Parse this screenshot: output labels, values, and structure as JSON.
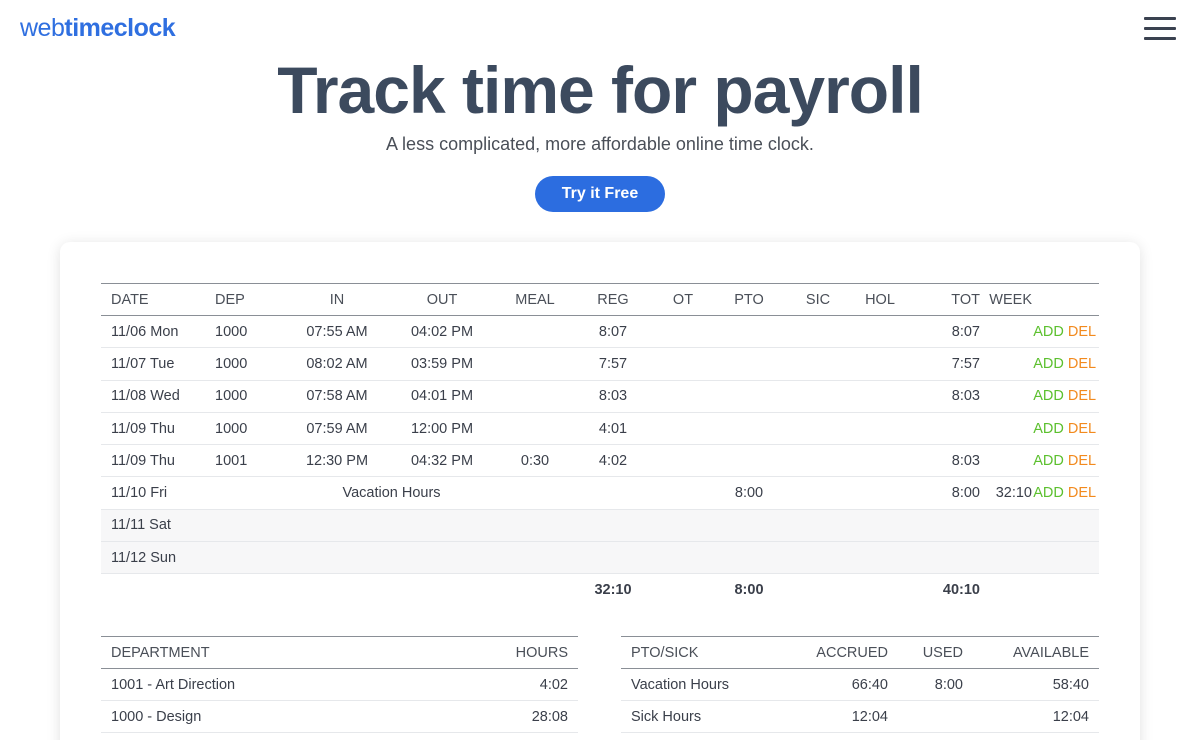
{
  "header": {
    "logo_thin": "web",
    "logo_bold": "timeclock",
    "menu_icon": "hamburger-menu-icon"
  },
  "hero": {
    "title": "Track time for payroll",
    "subtitle": "A less complicated, more affordable online time clock.",
    "cta_label": "Try it Free"
  },
  "colors": {
    "brand_blue": "#2c6de0",
    "title_slate": "#3c4a5e",
    "add_green": "#5cc02e",
    "del_orange": "#f28a1e"
  },
  "timesheet": {
    "columns": [
      "DATE",
      "DEP",
      "IN",
      "OUT",
      "MEAL",
      "REG",
      "OT",
      "PTO",
      "SIC",
      "HOL",
      "TOT",
      "WEEK",
      "",
      ""
    ],
    "rows": [
      {
        "date": "11/06 Mon",
        "dep": "1000",
        "in": "07:55 AM",
        "out": "04:02 PM",
        "meal": "",
        "reg": "8:07",
        "ot": "",
        "pto": "",
        "sic": "",
        "hol": "",
        "tot": "8:07",
        "week": "",
        "add": "ADD",
        "del": "DEL"
      },
      {
        "date": "11/07 Tue",
        "dep": "1000",
        "in": "08:02 AM",
        "out": "03:59 PM",
        "meal": "",
        "reg": "7:57",
        "ot": "",
        "pto": "",
        "sic": "",
        "hol": "",
        "tot": "7:57",
        "week": "",
        "add": "ADD",
        "del": "DEL"
      },
      {
        "date": "11/08 Wed",
        "dep": "1000",
        "in": "07:58 AM",
        "out": "04:01 PM",
        "meal": "",
        "reg": "8:03",
        "ot": "",
        "pto": "",
        "sic": "",
        "hol": "",
        "tot": "8:03",
        "week": "",
        "add": "ADD",
        "del": "DEL"
      },
      {
        "date": "11/09 Thu",
        "dep": "1000",
        "in": "07:59 AM",
        "out": "12:00 PM",
        "meal": "",
        "reg": "4:01",
        "ot": "",
        "pto": "",
        "sic": "",
        "hol": "",
        "tot": "",
        "week": "",
        "add": "ADD",
        "del": "DEL"
      },
      {
        "date": "11/09 Thu",
        "dep": "1001",
        "in": "12:30 PM",
        "out": "04:32 PM",
        "meal": "0:30",
        "reg": "4:02",
        "ot": "",
        "pto": "",
        "sic": "",
        "hol": "",
        "tot": "8:03",
        "week": "",
        "add": "ADD",
        "del": "DEL"
      },
      {
        "date": "11/10 Fri",
        "note": "Vacation Hours",
        "reg": "",
        "ot": "",
        "pto": "8:00",
        "sic": "",
        "hol": "",
        "tot": "8:00",
        "week": "32:10",
        "add": "ADD",
        "del": "DEL"
      },
      {
        "date": "11/11 Sat",
        "weekend": true
      },
      {
        "date": "11/12 Sun",
        "weekend": true
      }
    ],
    "totals": {
      "reg": "32:10",
      "pto": "8:00",
      "tot": "40:10"
    }
  },
  "departments": {
    "columns": [
      "DEPARTMENT",
      "HOURS"
    ],
    "rows": [
      {
        "name": "1001 - Art Direction",
        "hours": "4:02"
      },
      {
        "name": "1000 - Design",
        "hours": "28:08"
      }
    ]
  },
  "pto_sick": {
    "columns": [
      "PTO/SICK",
      "ACCRUED",
      "USED",
      "AVAILABLE"
    ],
    "rows": [
      {
        "type": "Vacation Hours",
        "accrued": "66:40",
        "used": "8:00",
        "available": "58:40"
      },
      {
        "type": "Sick Hours",
        "accrued": "12:04",
        "used": "",
        "available": "12:04"
      }
    ]
  }
}
